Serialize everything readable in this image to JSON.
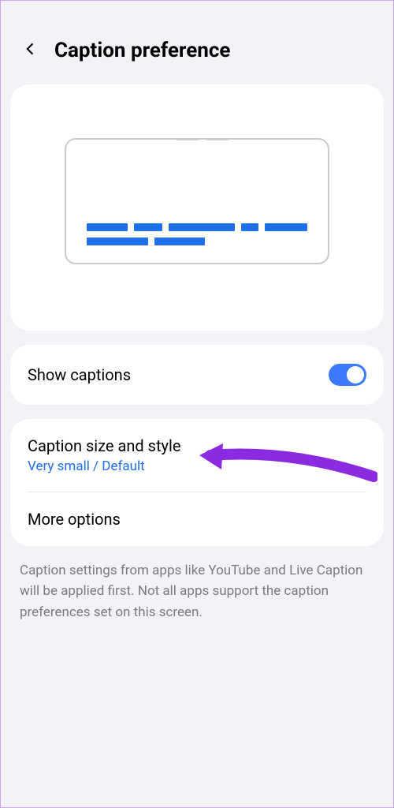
{
  "header": {
    "title": "Caption preference"
  },
  "show_captions": {
    "label": "Show captions",
    "on": true
  },
  "caption_style": {
    "title": "Caption size and style",
    "subtitle": "Very small / Default"
  },
  "more_options": {
    "label": "More options"
  },
  "footer": {
    "text": "Caption settings from apps like YouTube and Live Caption will be applied first. Not all apps support the caption preferences set on this screen."
  },
  "colors": {
    "accent": "#3a7afe",
    "annotation": "#8a2be2"
  }
}
